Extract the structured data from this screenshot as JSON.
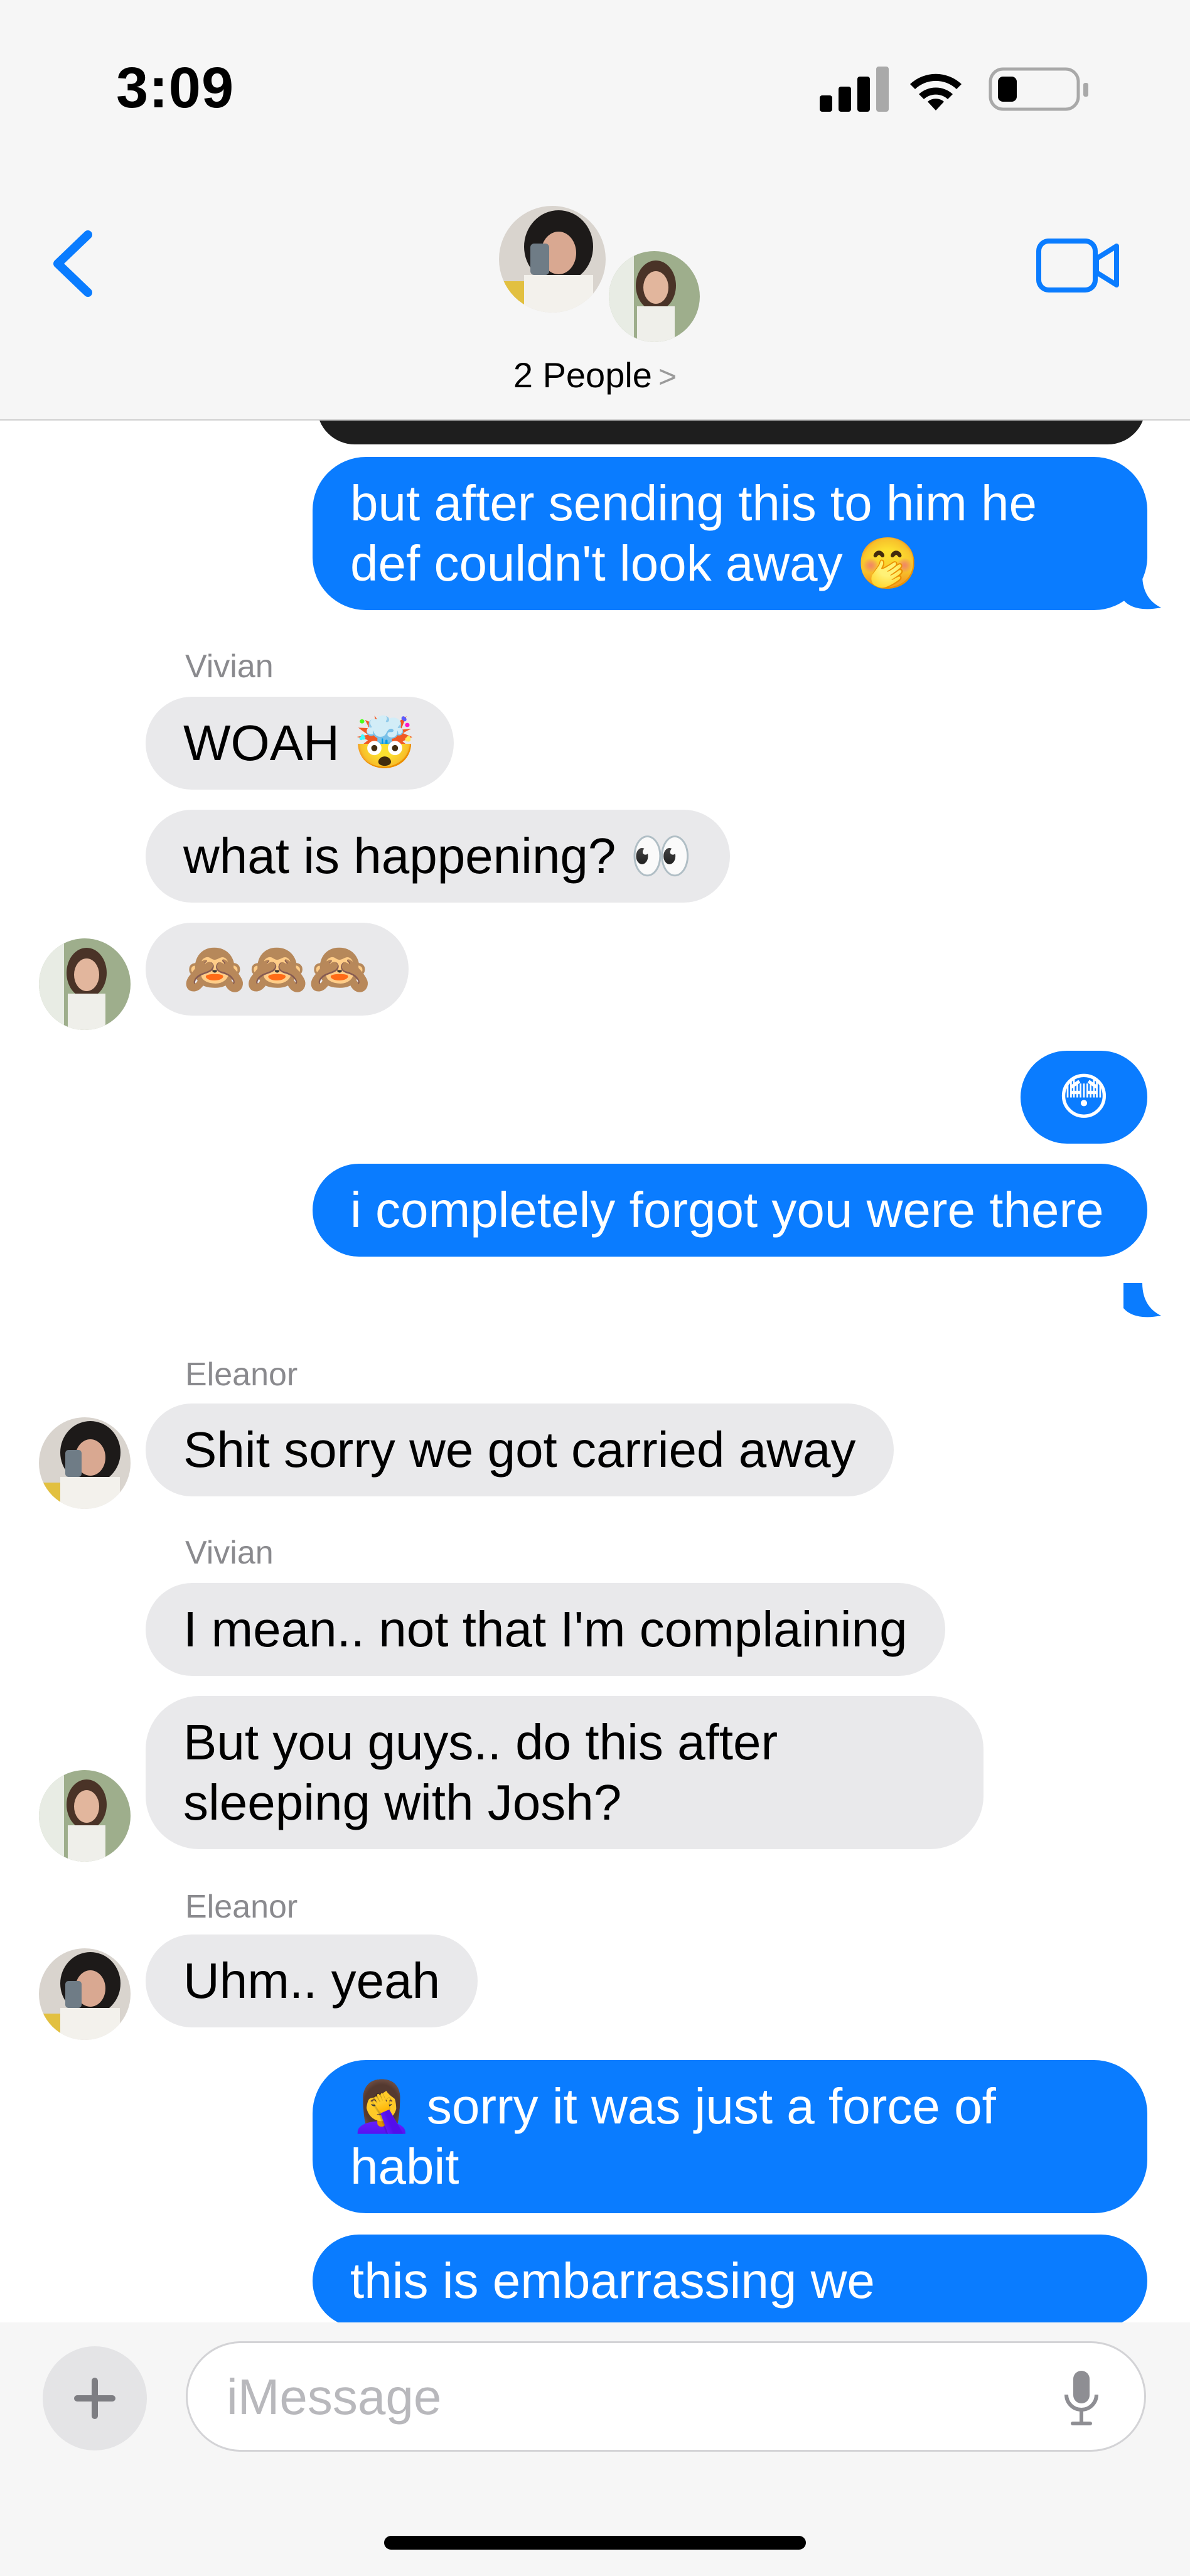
{
  "status_bar": {
    "time": "3:09"
  },
  "header": {
    "participants_label": "2 People",
    "chevron": ">"
  },
  "messages": [
    {
      "type": "out",
      "text": "but after sending this to him he def couldn't look away 🤭"
    },
    {
      "type": "sender",
      "text": "Vivian"
    },
    {
      "type": "in",
      "text": "WOAH 🤯"
    },
    {
      "type": "in",
      "text": "what is happening? 👀"
    },
    {
      "type": "in",
      "text": "🙈🙈🙈"
    },
    {
      "type": "out",
      "text": "😳"
    },
    {
      "type": "out",
      "text": "i completely forgot you were there"
    },
    {
      "type": "sender",
      "text": "Eleanor"
    },
    {
      "type": "in",
      "text": "Shit sorry we got carried away"
    },
    {
      "type": "sender",
      "text": "Vivian"
    },
    {
      "type": "in",
      "text": "I mean.. not that I'm complaining"
    },
    {
      "type": "in",
      "text": "But you guys.. do this after sleeping with Josh?"
    },
    {
      "type": "sender",
      "text": "Eleanor"
    },
    {
      "type": "in",
      "text": "Uhm.. yeah"
    },
    {
      "type": "out",
      "text": "🤦‍♀️ sorry it was just a force of habit"
    },
    {
      "type": "out",
      "text": "this is embarrassing we"
    }
  ],
  "input": {
    "placeholder": "iMessage",
    "plus": "+"
  },
  "colors": {
    "accent": "#0a7cff",
    "incoming": "#e9e9eb",
    "header_bg": "#f6f6f6"
  }
}
